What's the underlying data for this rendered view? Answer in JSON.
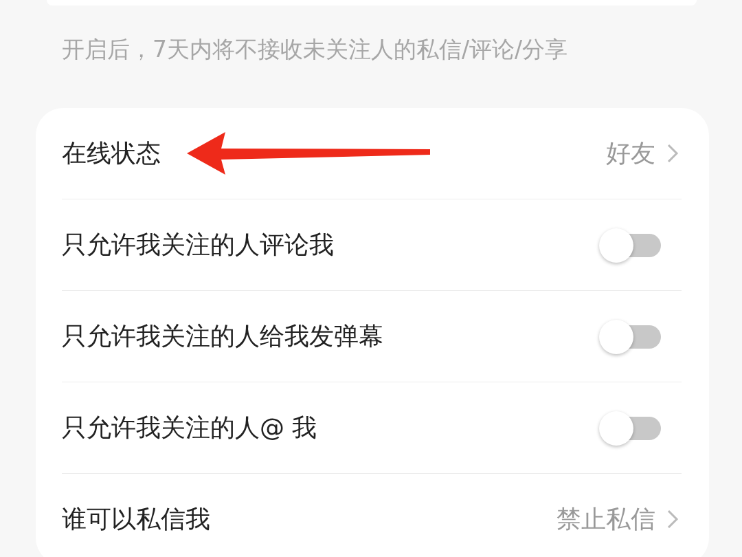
{
  "note": "开启后，7天内将不接收未关注人的私信/评论/分享",
  "settings": [
    {
      "kind": "link",
      "label": "在线状态",
      "value": "好友"
    },
    {
      "kind": "toggle",
      "label": "只允许我关注的人评论我",
      "on": false
    },
    {
      "kind": "toggle",
      "label": "只允许我关注的人给我发弹幕",
      "on": false
    },
    {
      "kind": "toggle",
      "label": "只允许我关注的人@ 我",
      "on": false
    },
    {
      "kind": "link",
      "label": "谁可以私信我",
      "value": "禁止私信"
    }
  ]
}
